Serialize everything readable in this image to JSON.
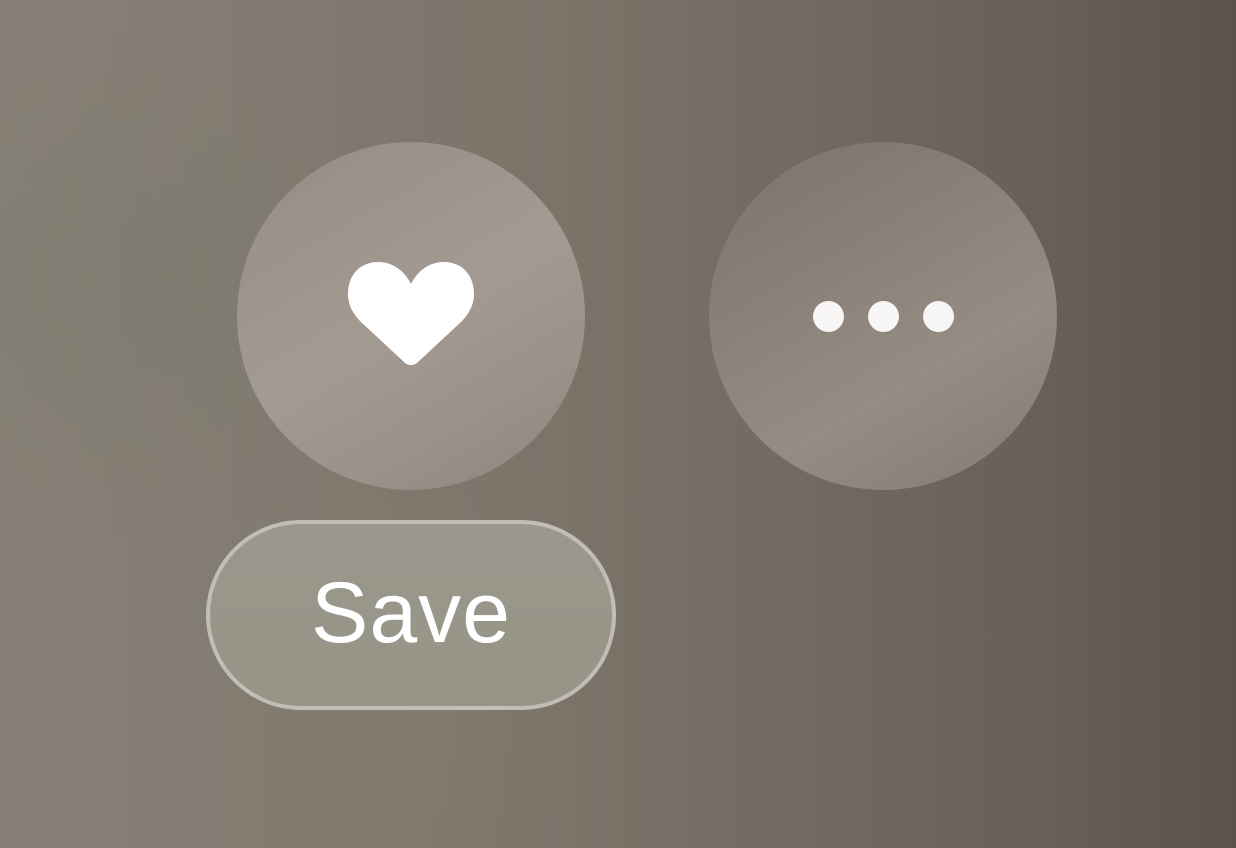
{
  "controls": {
    "like_button": {
      "icon": "heart-icon"
    },
    "more_button": {
      "icon": "more-dots-icon"
    },
    "save_button": {
      "label": "Save"
    }
  },
  "colors": {
    "icon": "#ffffff",
    "background_left": "#878076",
    "background_right": "#5a524c"
  }
}
